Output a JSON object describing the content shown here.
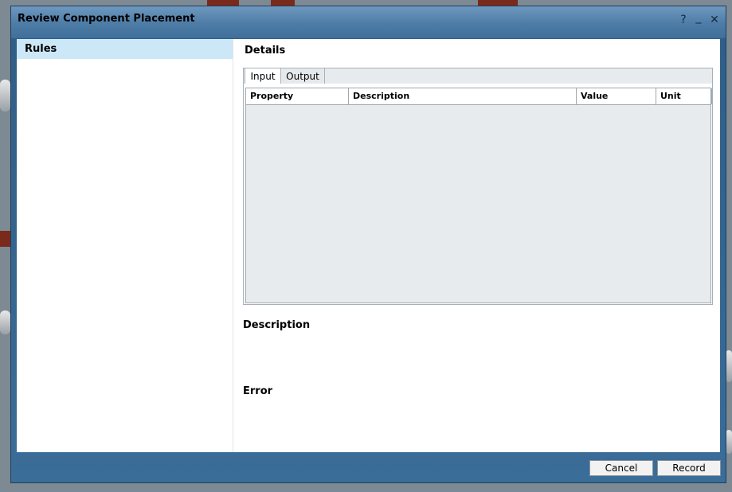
{
  "window": {
    "title": "Review Component Placement"
  },
  "titlebar_buttons": {
    "help": "?",
    "minimize": "_",
    "close": "✕"
  },
  "left": {
    "rules_header": "Rules"
  },
  "details": {
    "title": "Details",
    "tabs": [
      "Input",
      "Output"
    ],
    "active_tab": "Input",
    "columns": [
      "Property",
      "Description",
      "Value",
      "Unit"
    ]
  },
  "description": {
    "title": "Description"
  },
  "error": {
    "title": "Error"
  },
  "footer": {
    "cancel_label": "Cancel",
    "record_label": "Record"
  },
  "colors": {
    "frame": "#2f5d86",
    "selection": "#cce8f8",
    "grid_bg": "#e8ebee"
  }
}
